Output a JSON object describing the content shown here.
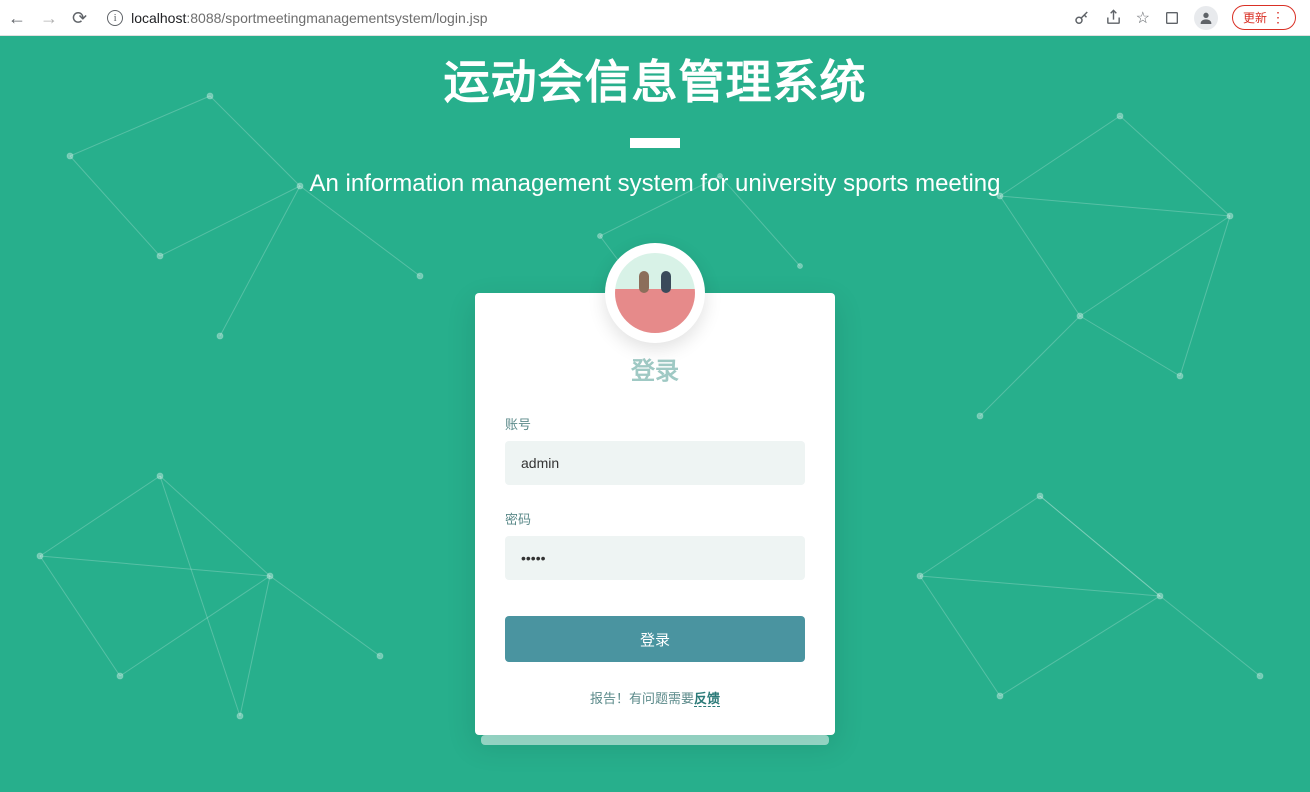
{
  "browser": {
    "url_host": "localhost",
    "url_port_path": ":8088/sportmeetingmanagementsystem/login.jsp",
    "update_label": "更新"
  },
  "hero": {
    "title": "运动会信息管理系统",
    "subtitle": "An information management system for university sports meeting"
  },
  "login": {
    "title": "登录",
    "username_label": "账号",
    "username_value": "admin",
    "password_label": "密码",
    "password_value": "•••••",
    "submit_label": "登录",
    "feedback_prefix": "报告！有问题需要",
    "feedback_link": "反馈"
  }
}
